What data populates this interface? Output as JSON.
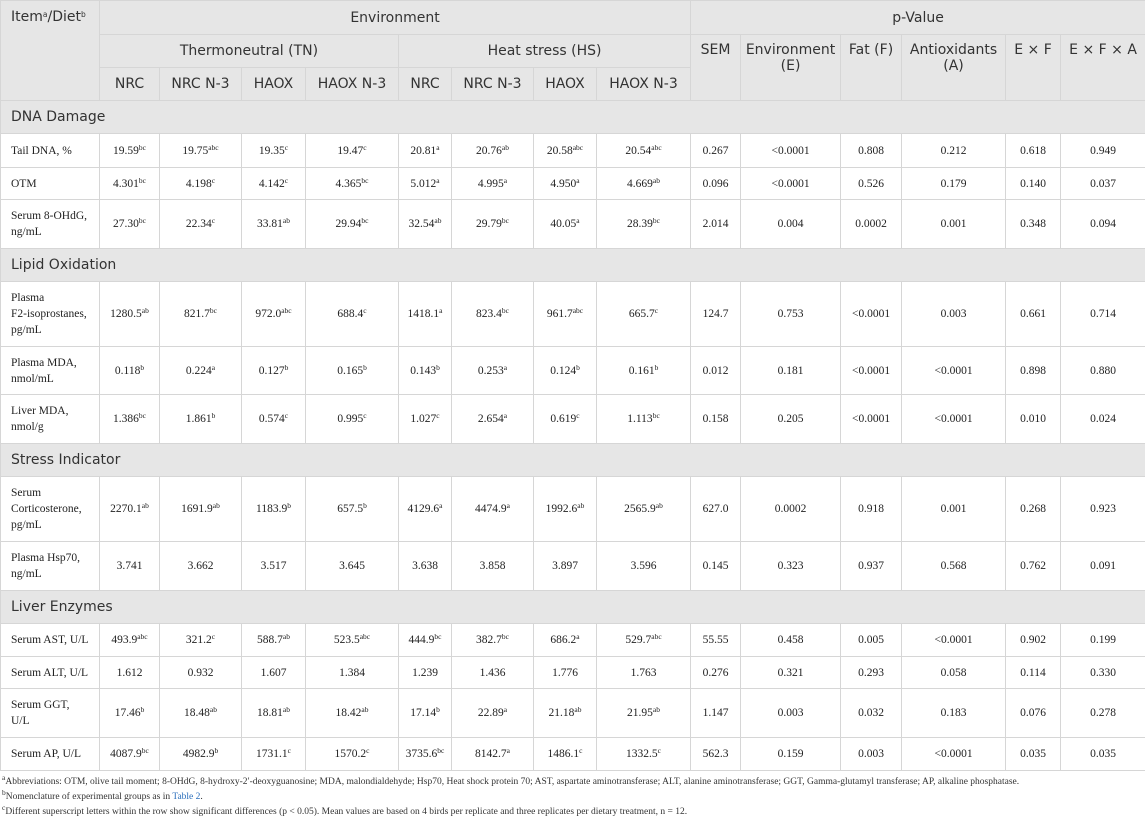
{
  "header": {
    "item_label": "Item",
    "item_sup_a": "a",
    "item_sep": "/Diet",
    "item_sup_b": "b",
    "environment": "Environment",
    "p_value": "p-Value",
    "tn": "Thermoneutral (TN)",
    "hs": "Heat stress (HS)",
    "diets": [
      "NRC",
      "NRC N-3",
      "HAOX",
      "HAOX N-3",
      "NRC",
      "NRC N-3",
      "HAOX",
      "HAOX N-3"
    ],
    "pcols": [
      "SEM",
      "Environment (E)",
      "Fat (F)",
      "Antioxidants (A)",
      "E × F",
      "E × F × A"
    ]
  },
  "sections": [
    {
      "title": "DNA Damage",
      "rows": [
        {
          "item": [
            "Tail DNA, %"
          ],
          "vals": [
            [
              "19.59",
              "bc"
            ],
            [
              "19.75",
              "abc"
            ],
            [
              "19.35",
              "c"
            ],
            [
              "19.47",
              "c"
            ],
            [
              "20.81",
              "a"
            ],
            [
              "20.76",
              "ab"
            ],
            [
              "20.58",
              "abc"
            ],
            [
              "20.54",
              "abc"
            ]
          ],
          "p": [
            "0.267",
            "<0.0001",
            "0.808",
            "0.212",
            "0.618",
            "0.949"
          ],
          "h": 34
        },
        {
          "item": [
            "OTM"
          ],
          "vals": [
            [
              "4.301",
              "bc"
            ],
            [
              "4.198",
              "c"
            ],
            [
              "4.142",
              "c"
            ],
            [
              "4.365",
              "bc"
            ],
            [
              "5.012",
              "a"
            ],
            [
              "4.995",
              "a"
            ],
            [
              "4.950",
              "a"
            ],
            [
              "4.669",
              "ab"
            ]
          ],
          "p": [
            "0.096",
            "<0.0001",
            "0.526",
            "0.179",
            "0.140",
            "0.037"
          ],
          "h": 32
        },
        {
          "item": [
            "Serum 8-OHdG,",
            "ng/mL"
          ],
          "vals": [
            [
              "27.30",
              "bc"
            ],
            [
              "22.34",
              "c"
            ],
            [
              "33.81",
              "ab"
            ],
            [
              "29.94",
              "bc"
            ],
            [
              "32.54",
              "ab"
            ],
            [
              "29.79",
              "bc"
            ],
            [
              "40.05",
              "a"
            ],
            [
              "28.39",
              "bc"
            ]
          ],
          "p": [
            "2.014",
            "0.004",
            "0.0002",
            "0.001",
            "0.348",
            "0.094"
          ],
          "h": 49
        }
      ]
    },
    {
      "title": "Lipid Oxidation",
      "rows": [
        {
          "item": [
            "Plasma",
            "F2-isoprostanes,",
            "pg/mL"
          ],
          "vals": [
            [
              "1280.5",
              "ab"
            ],
            [
              "821.7",
              "bc"
            ],
            [
              "972.0",
              "abc"
            ],
            [
              "688.4",
              "c"
            ],
            [
              "1418.1",
              "a"
            ],
            [
              "823.4",
              "bc"
            ],
            [
              "961.7",
              "abc"
            ],
            [
              "665.7",
              "c"
            ]
          ],
          "p": [
            "124.7",
            "0.753",
            "<0.0001",
            "0.003",
            "0.661",
            "0.714"
          ],
          "h": 65
        },
        {
          "item": [
            "Plasma MDA,",
            "nmol/mL"
          ],
          "vals": [
            [
              "0.118",
              "b"
            ],
            [
              "0.224",
              "a"
            ],
            [
              "0.127",
              "b"
            ],
            [
              "0.165",
              "b"
            ],
            [
              "0.143",
              "b"
            ],
            [
              "0.253",
              "a"
            ],
            [
              "0.124",
              "b"
            ],
            [
              "0.161",
              "b"
            ]
          ],
          "p": [
            "0.012",
            "0.181",
            "<0.0001",
            "<0.0001",
            "0.898",
            "0.880"
          ],
          "h": 48
        },
        {
          "item": [
            "Liver MDA,",
            "nmol/g"
          ],
          "vals": [
            [
              "1.386",
              "bc"
            ],
            [
              "1.861",
              "b"
            ],
            [
              "0.574",
              "c"
            ],
            [
              "0.995",
              "c"
            ],
            [
              "1.027",
              "c"
            ],
            [
              "2.654",
              "a"
            ],
            [
              "0.619",
              "c"
            ],
            [
              "1.113",
              "bc"
            ]
          ],
          "p": [
            "0.158",
            "0.205",
            "<0.0001",
            "<0.0001",
            "0.010",
            "0.024"
          ],
          "h": 49
        }
      ]
    },
    {
      "title": "Stress Indicator",
      "rows": [
        {
          "item": [
            "Serum",
            "Corticosterone,",
            "pg/mL"
          ],
          "vals": [
            [
              "2270.1",
              "ab"
            ],
            [
              "1691.9",
              "ab"
            ],
            [
              "1183.9",
              "b"
            ],
            [
              "657.5",
              "b"
            ],
            [
              "4129.6",
              "a"
            ],
            [
              "4474.9",
              "a"
            ],
            [
              "1992.6",
              "ab"
            ],
            [
              "2565.9",
              "ab"
            ]
          ],
          "p": [
            "627.0",
            "0.0002",
            "0.918",
            "0.001",
            "0.268",
            "0.923"
          ],
          "h": 65
        },
        {
          "item": [
            "Plasma Hsp70,",
            "ng/mL"
          ],
          "vals": [
            [
              "3.741",
              ""
            ],
            [
              "3.662",
              ""
            ],
            [
              "3.517",
              ""
            ],
            [
              "3.645",
              ""
            ],
            [
              "3.638",
              ""
            ],
            [
              "3.858",
              ""
            ],
            [
              "3.897",
              ""
            ],
            [
              "3.596",
              ""
            ]
          ],
          "p": [
            "0.145",
            "0.323",
            "0.937",
            "0.568",
            "0.762",
            "0.091"
          ],
          "h": 49
        }
      ]
    },
    {
      "title": "Liver Enzymes",
      "rows": [
        {
          "item": [
            "Serum AST, U/L"
          ],
          "vals": [
            [
              "493.9",
              "abc"
            ],
            [
              "321.2",
              "c"
            ],
            [
              "588.7",
              "ab"
            ],
            [
              "523.5",
              "abc"
            ],
            [
              "444.9",
              "bc"
            ],
            [
              "382.7",
              "bc"
            ],
            [
              "686.2",
              "a"
            ],
            [
              "529.7",
              "abc"
            ]
          ],
          "p": [
            "55.55",
            "0.458",
            "0.005",
            "<0.0001",
            "0.902",
            "0.199"
          ],
          "h": 33
        },
        {
          "item": [
            "Serum ALT, U/L"
          ],
          "vals": [
            [
              "1.612",
              ""
            ],
            [
              "0.932",
              ""
            ],
            [
              "1.607",
              ""
            ],
            [
              "1.384",
              ""
            ],
            [
              "1.239",
              ""
            ],
            [
              "1.436",
              ""
            ],
            [
              "1.776",
              ""
            ],
            [
              "1.763",
              ""
            ]
          ],
          "p": [
            "0.276",
            "0.321",
            "0.293",
            "0.058",
            "0.114",
            "0.330"
          ],
          "h": 32
        },
        {
          "item": [
            "Serum GGT,",
            "U/L"
          ],
          "vals": [
            [
              "17.46",
              "b"
            ],
            [
              "18.48",
              "ab"
            ],
            [
              "18.81",
              "ab"
            ],
            [
              "18.42",
              "ab"
            ],
            [
              "17.14",
              "b"
            ],
            [
              "22.89",
              "a"
            ],
            [
              "21.18",
              "ab"
            ],
            [
              "21.95",
              "ab"
            ]
          ],
          "p": [
            "1.147",
            "0.003",
            "0.032",
            "0.183",
            "0.076",
            "0.278"
          ],
          "h": 49
        },
        {
          "item": [
            "Serum AP, U/L"
          ],
          "vals": [
            [
              "4087.9",
              "bc"
            ],
            [
              "4982.9",
              "b"
            ],
            [
              "1731.1",
              "c"
            ],
            [
              "1570.2",
              "c"
            ],
            [
              "3735.6",
              "bc"
            ],
            [
              "8142.7",
              "a"
            ],
            [
              "1486.1",
              "c"
            ],
            [
              "1332.5",
              "c"
            ]
          ],
          "p": [
            "562.3",
            "0.159",
            "0.003",
            "<0.0001",
            "0.035",
            "0.035"
          ],
          "h": 33
        }
      ]
    }
  ],
  "footnotes": {
    "a": {
      "sup": "a",
      "text": "Abbreviations: OTM, olive tail moment; 8-OHdG, 8-hydroxy-2′-deoxyguanosine; MDA, malondialdehyde; Hsp70, Heat shock protein 70; AST, aspartate aminotransferase; ALT, alanine aminotransferase; GGT, Gamma-glutamyl transferase; AP, alkaline phosphatase."
    },
    "b": {
      "sup": "b",
      "text": "Nomenclature of experimental groups as in ",
      "ref": "Table 2",
      "end": "."
    },
    "c": {
      "sup": "c",
      "text": "Different superscript letters within the row show significant differences (p < 0.05). Mean values are based on 4 birds per replicate and three replicates per dietary treatment, n = 12."
    }
  }
}
